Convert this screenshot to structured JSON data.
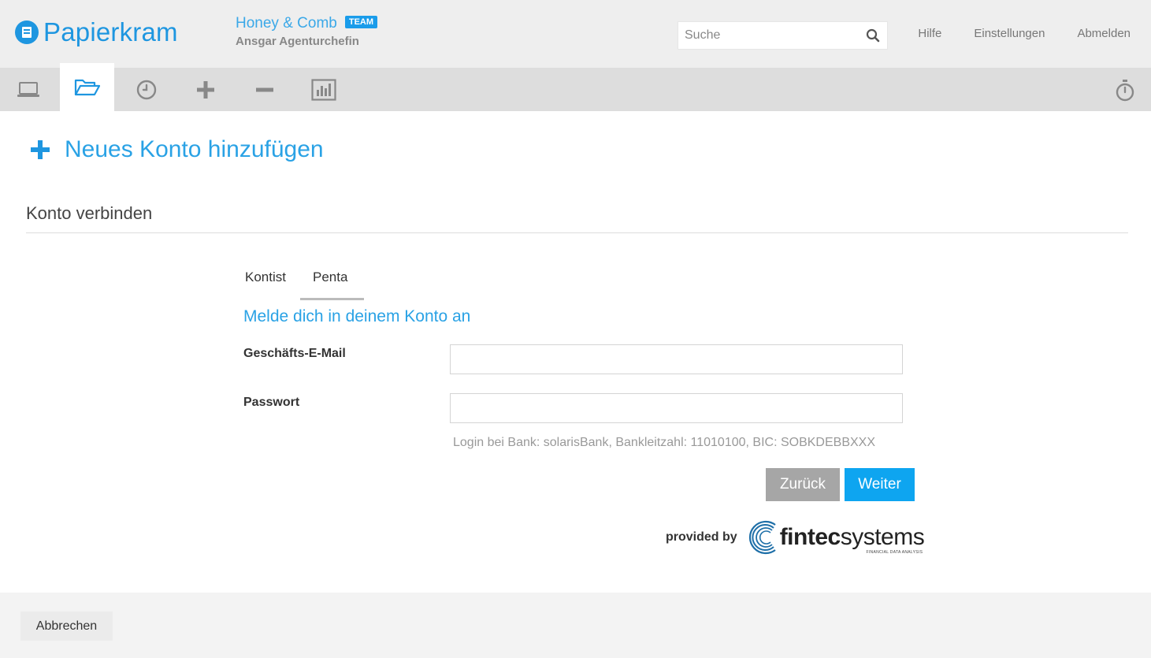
{
  "app": {
    "logo_text": "Papierkram",
    "company_name": "Honey & Comb",
    "team_badge": "TEAM",
    "user_name": "Ansgar Agenturchefin"
  },
  "search": {
    "placeholder": "Suche"
  },
  "toplinks": {
    "help": "Hilfe",
    "settings": "Einstellungen",
    "logout": "Abmelden"
  },
  "nav": {
    "items": [
      {
        "icon": "laptop-icon"
      },
      {
        "icon": "folder-open-icon"
      },
      {
        "icon": "clock-icon"
      },
      {
        "icon": "plus-icon"
      },
      {
        "icon": "minus-icon"
      },
      {
        "icon": "bar-chart-icon"
      }
    ],
    "active_index": 1,
    "right_icon": "stopwatch-icon"
  },
  "page": {
    "title": "Neues Konto hinzufügen",
    "section_title": "Konto verbinden"
  },
  "tabs": [
    {
      "label": "Kontist",
      "active": false
    },
    {
      "label": "Penta",
      "active": true
    }
  ],
  "form": {
    "heading": "Melde dich in deinem Konto an",
    "email_label": "Geschäfts-E-Mail",
    "email_value": "",
    "password_label": "Passwort",
    "password_value": "",
    "hint": "Login bei Bank: solarisBank, Bankleitzahl: 11010100, BIC: SOBKDEBBXXX",
    "back_label": "Zurück",
    "next_label": "Weiter"
  },
  "provider": {
    "label": "provided by",
    "name_bold": "fintec",
    "name_light": "systems",
    "tagline": "FINANCIAL DATA ANALYSIS"
  },
  "footer": {
    "cancel_label": "Abbrechen"
  },
  "colors": {
    "accent": "#1e96e0",
    "button_primary": "#0ea5f0",
    "button_secondary": "#a6a6a6"
  }
}
